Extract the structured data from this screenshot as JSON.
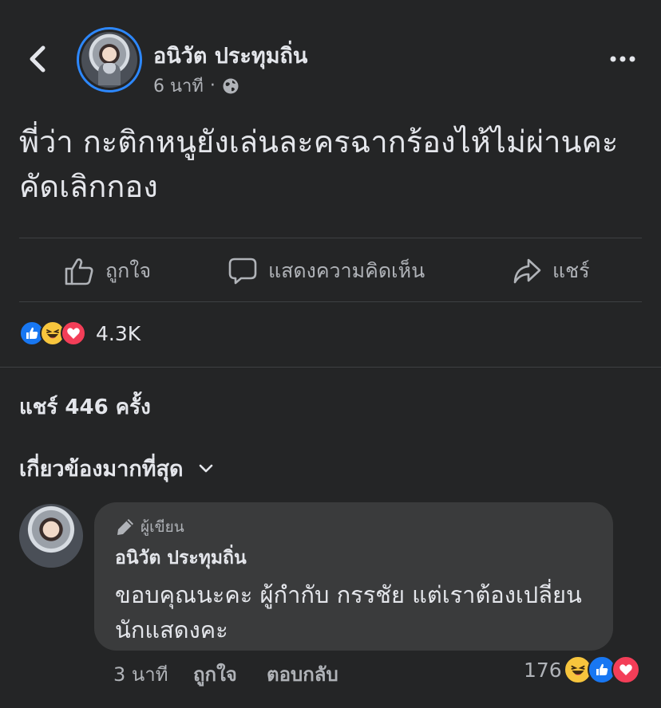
{
  "post": {
    "author": "อนิวัต ประทุมถิ่น",
    "time": "6 นาที",
    "separator": "·",
    "text": "พี่ว่า กะติกหนูยังเล่นละครฉากร้องไห้ไม่ผ่านคะ คัดเลิกกอง"
  },
  "actions": {
    "like": "ถูกใจ",
    "comment": "แสดงความคิดเห็น",
    "share": "แชร์"
  },
  "reactions": {
    "count": "4.3K",
    "types": [
      "like",
      "haha",
      "love"
    ]
  },
  "shares": "แชร์ 446 ครั้ง",
  "sort": {
    "label": "เกี่ยวข้องมากที่สุด"
  },
  "comment": {
    "badge": "ผู้เขียน",
    "author": "อนิวัต ประทุมถิ่น",
    "text": "ขอบคุณนะคะ ผู้กำกับ กรรชัย แต่เราต้องเปลี่ยนนักแสดงคะ",
    "time": "3 นาที",
    "like": "ถูกใจ",
    "reply": "ตอบกลับ",
    "reaction_count": "176",
    "reaction_types": [
      "haha",
      "like",
      "love"
    ]
  },
  "colors": {
    "background": "#242526",
    "bubble": "#3a3b3c",
    "accent_blue": "#2d88ff",
    "like_blue": "#1877f2",
    "love_red": "#f33e58",
    "haha_yellow": "#f7c53d"
  },
  "icons": [
    "chevron-left-icon",
    "globe-icon",
    "more-dots-icon",
    "thumbs-up-icon",
    "comment-bubble-icon",
    "share-arrow-icon",
    "chevron-down-icon",
    "pen-icon"
  ]
}
